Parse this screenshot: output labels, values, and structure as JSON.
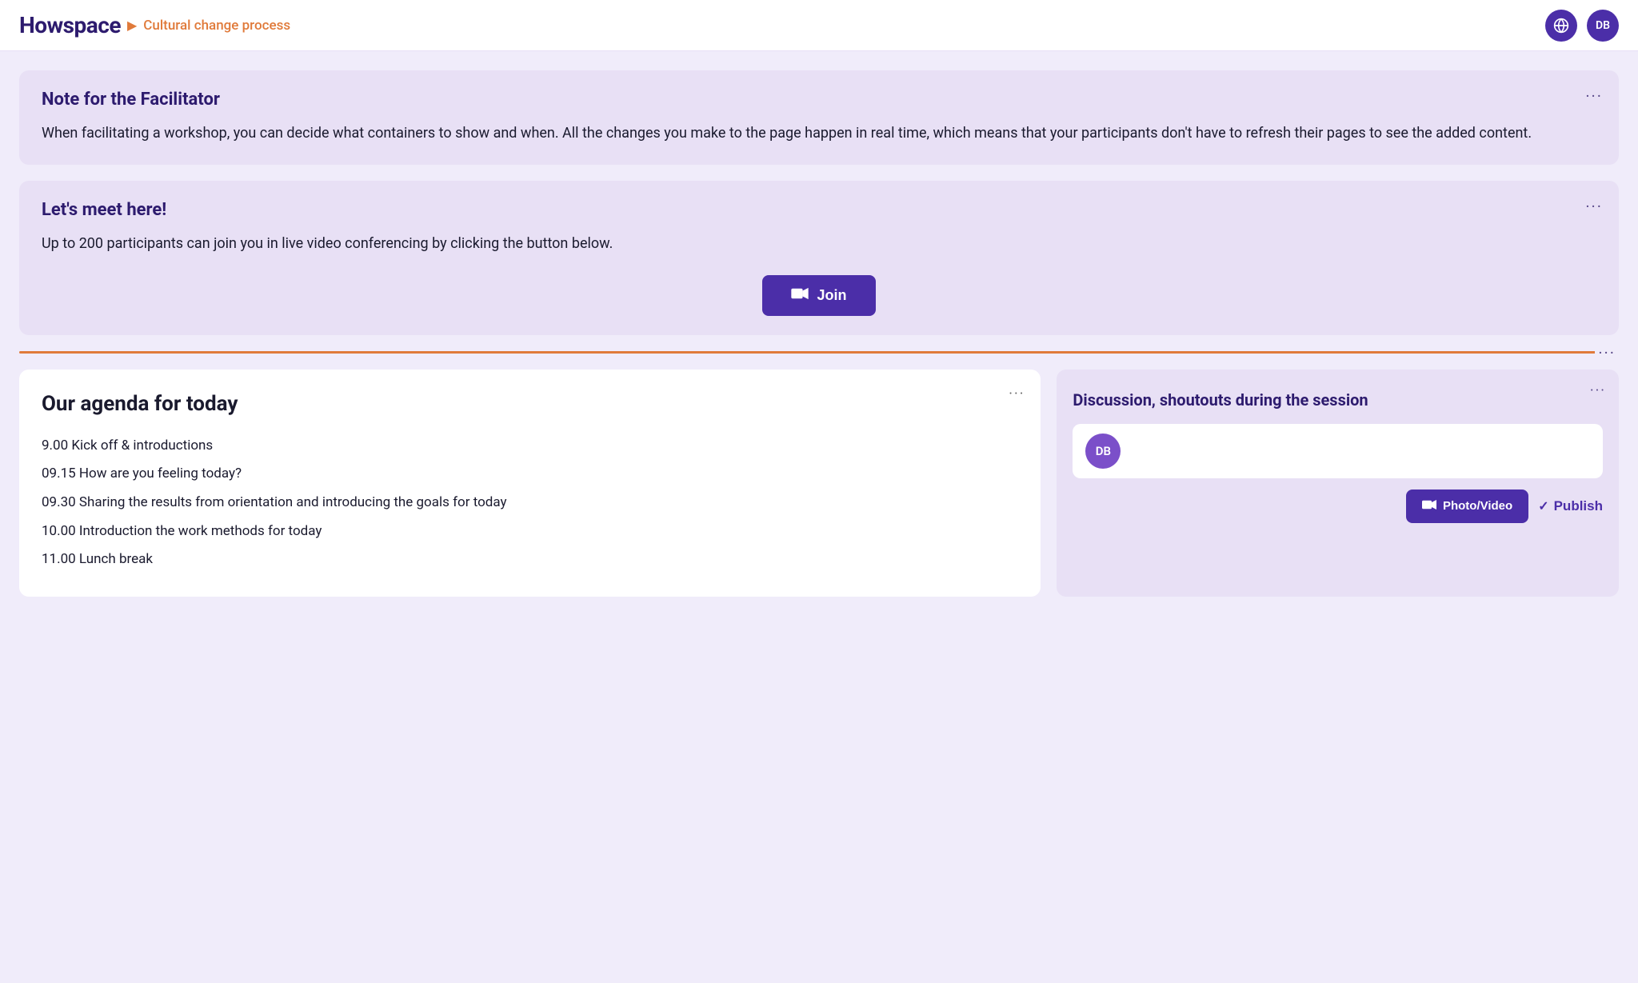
{
  "header": {
    "logo": "Howspace",
    "breadcrumb_sep": "▶",
    "breadcrumb_text": "Cultural change process",
    "icon_btn_label": "⊕",
    "avatar_text": "DB"
  },
  "facilitator_note": {
    "title": "Note for the Facilitator",
    "body": "When facilitating a workshop, you can decide what containers to show and when. All the changes you make to the page happen in real time, which means that your participants don't have to refresh their pages to see the added content.",
    "menu": "···"
  },
  "video_section": {
    "title": "Let's meet here!",
    "body": "Up to 200 participants can join you in live video conferencing by clicking the button below.",
    "join_label": "Join",
    "menu": "···"
  },
  "divider": {
    "menu": "···"
  },
  "agenda": {
    "title": "Our agenda for today",
    "items": [
      "9.00 Kick off & introductions",
      "09.15 How are you feeling today?",
      "09.30 Sharing the results from orientation and introducing the goals for today",
      "10.00 Introduction the work methods for today",
      "11.00 Lunch break"
    ],
    "menu": "···"
  },
  "discussion": {
    "title": "Discussion, shoutouts during the session",
    "menu": "···",
    "avatar_text": "DB",
    "input_placeholder": "",
    "photo_video_label": "Photo/Video",
    "publish_label": "Publish"
  },
  "colors": {
    "purple_dark": "#2d1b6e",
    "purple_btn": "#4b2ea8",
    "orange": "#e07a3a",
    "bg": "#f0ecfa",
    "card_bg": "#e8e0f5",
    "white": "#ffffff"
  }
}
